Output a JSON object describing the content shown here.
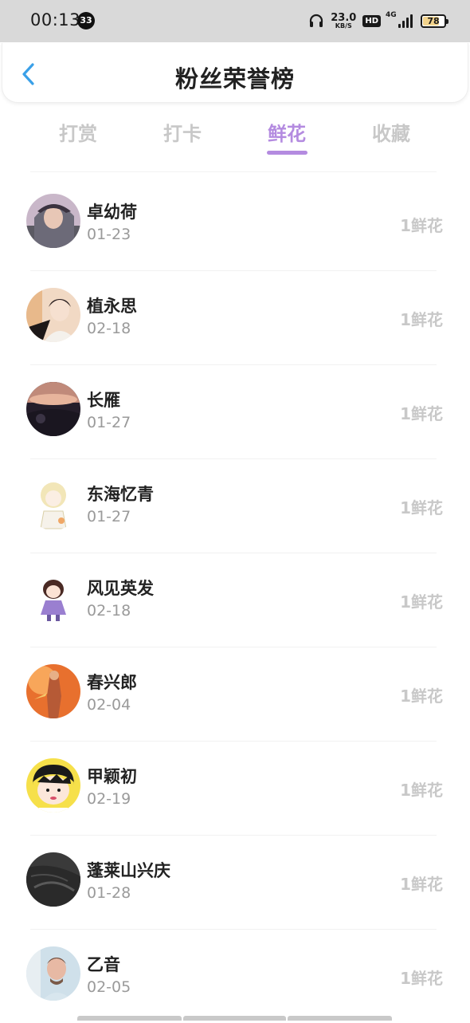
{
  "status_bar": {
    "time": "00:13",
    "notification_count": "33",
    "net_speed_value": "23.0",
    "net_speed_unit": "KB/S",
    "hd_label": "HD",
    "network_label": "4G",
    "battery_level": "78",
    "battery_fraction": 0.78
  },
  "header": {
    "back_icon": "chevron-left-icon",
    "title": "粉丝荣誉榜",
    "accent_color": "#3aa0e8"
  },
  "tabs": {
    "items": [
      {
        "label": "打赏",
        "active": false
      },
      {
        "label": "打卡",
        "active": false
      },
      {
        "label": "鲜花",
        "active": true
      },
      {
        "label": "收藏",
        "active": false
      }
    ],
    "active_color": "#b48be0",
    "inactive_color": "#c8c8c8"
  },
  "fans": [
    {
      "name": "卓幼荷",
      "date": "01-23",
      "count": "1鲜花"
    },
    {
      "name": "植永思",
      "date": "02-18",
      "count": "1鲜花"
    },
    {
      "name": "长雁",
      "date": "01-27",
      "count": "1鲜花"
    },
    {
      "name": "东海忆青",
      "date": "01-27",
      "count": "1鲜花"
    },
    {
      "name": "风见英发",
      "date": "02-18",
      "count": "1鲜花"
    },
    {
      "name": "春兴郎",
      "date": "02-04",
      "count": "1鲜花"
    },
    {
      "name": "甲颖初",
      "date": "02-19",
      "count": "1鲜花"
    },
    {
      "name": "蓬莱山兴庆",
      "date": "01-28",
      "count": "1鲜花"
    },
    {
      "name": "乙音",
      "date": "02-05",
      "count": "1鲜花"
    }
  ]
}
